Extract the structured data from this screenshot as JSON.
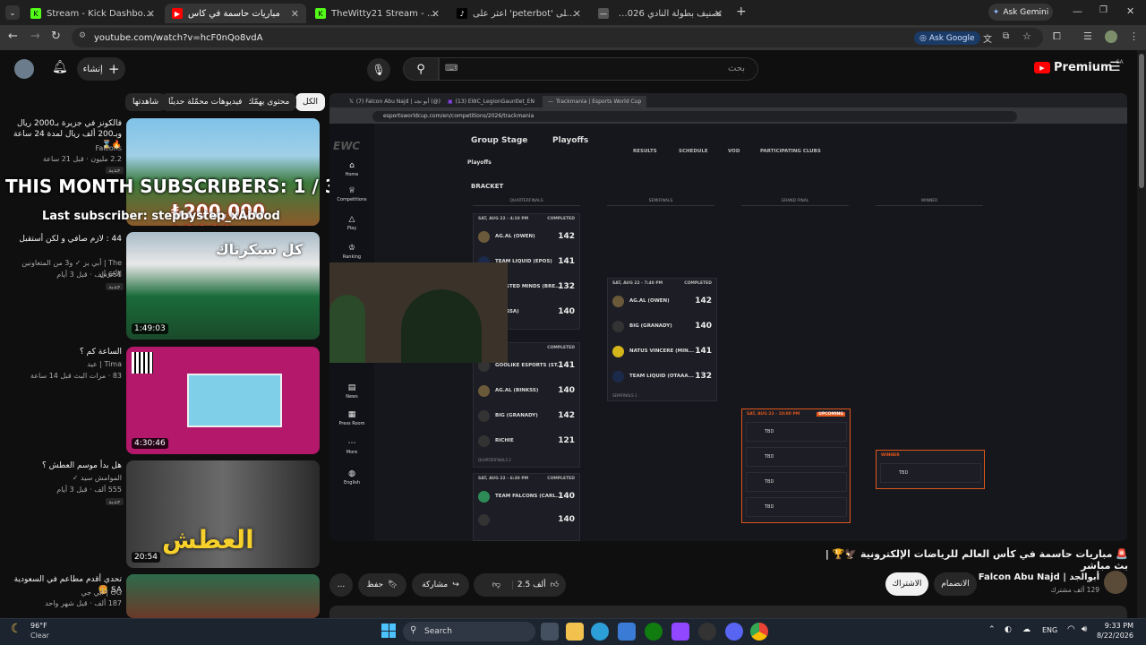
{
  "browser": {
    "tabs": [
      {
        "label": "Stream - Kick Dashboard",
        "icon": "kick-icon",
        "color": "#53fc18"
      },
      {
        "label": "مباريات حاسمة في كأس",
        "icon": "youtube-icon",
        "color": "#ff0000",
        "active": true
      },
      {
        "label": "TheWitty21 Stream - Watch Live",
        "icon": "kick-icon",
        "color": "#53fc18"
      },
      {
        "label": "اعثر على 'peterbot' على TikTok",
        "icon": "tiktok-icon",
        "color": "#000000"
      },
      {
        "label": "تصنيف بطولة النادي 2026 | كأس",
        "icon": "ewc-icon",
        "color": "#888888"
      }
    ],
    "ask_gemini": "Ask Gemini",
    "url": "youtube.com/watch?v=hcF0nQo8vdA",
    "ask_google": "Ask Google"
  },
  "youtube": {
    "create_label": "إنشاء",
    "search_placeholder": "بحث",
    "premium_label": "Premium",
    "premium_region": "SA",
    "chips": [
      "الكل",
      "محتوى يهمّك",
      "فيديوهات محمّلة حديثًا",
      "شاهدتها"
    ],
    "overlay_subs": "THIS MONTH SUBSCRIBERS: 1 / 30",
    "overlay_last": "Last subscriber: stepbystep_xAbood",
    "suggestions": [
      {
        "title": "فالكونز في جزيرة بـ2000 ريال وبـ200 ألف ريال لمدة 24 ساعة 🔥⌛",
        "channel": "Falcons",
        "meta": "2.2 مليون · قبل 21 ساعة",
        "badge": "جديد",
        "duration": ""
      },
      {
        "title": "44 : لازم صافي و لكن أستقبل",
        "channel": "The | أبي يز ✓ و3 من المتعاونين الآخرين",
        "meta": "651 ألف · قبل 3 أيام",
        "badge": "جديد",
        "duration": "1:49:03"
      },
      {
        "title": "الساعة كم ؟",
        "channel": "Tima | عيد",
        "meta": "83 · مرات البث قبل 14 ساعة",
        "badge": "جديد",
        "duration": "4:30:46"
      },
      {
        "title": "هل بدأ موسم العطش ؟",
        "channel": "الموامش سيد ✓",
        "meta": "555 ألف · قبل 3 أيام",
        "badge": "جديد",
        "duration": "20:54"
      },
      {
        "title": "تحدي أقدم مطاعم في السعودية SA 🍔",
        "channel": "OG | أبي جي",
        "meta": "187 ألف · قبل شهر واحد",
        "badge": "",
        "duration": ""
      }
    ],
    "video_title": "🚨 مباريات حاسمة في كأس العالم للرياضات الإلكترونية 🦅🏆 | بث مباشر",
    "channel_name": "أبوالجد | Falcon Abu Najd",
    "channel_subs": "129 ألف مشترك",
    "join_label": "الانضمام",
    "subscribe_label": "الاشتراك",
    "like_count": "2.5 ألف",
    "share_label": "مشاركة",
    "save_label": "حفظ",
    "more_label": "..."
  },
  "stream": {
    "inner_tabs": [
      "(7) Falcon Abu Najd | أبو نجد (@)",
      "(13) EWC_LegionGauntlet_EN",
      "Trackmania | Esports World Cup"
    ],
    "inner_url": "esportsworldcup.com/en/competitions/2026/trackmania",
    "ewc_logo": "EWC",
    "sidebar": [
      "Home",
      "Competitions",
      "Play",
      "Ranking",
      "Fan Fest",
      "News",
      "Press Room",
      "More",
      "English"
    ],
    "stages": [
      "Group Stage",
      "Playoffs"
    ],
    "subtabs": [
      "RESULTS",
      "SCHEDULE",
      "VOD",
      "PARTICIPATING CLUBS"
    ],
    "playoffs_label": "Playoffs",
    "bracket_label": "BRACKET",
    "columns": [
      "QUARTERFINALS",
      "SEMIFINALS",
      "GRAND FINAL",
      "WINNER"
    ],
    "quarterfinals": [
      {
        "date": "SAT, AUG 22 - 4:10 PM",
        "status": "COMPLETED",
        "teams": [
          [
            "AG.AL (OWEN)",
            "142"
          ],
          [
            "TEAM LIQUID (EPOS)",
            "141"
          ],
          [
            "TWISTED MINDS (BRE...",
            "132"
          ],
          [
            "(MASSA)",
            "140"
          ]
        ]
      },
      {
        "date": "5:30 PM",
        "status": "COMPLETED",
        "teams": [
          [
            "GOOLIKE ESPORTS (ST...",
            "141"
          ],
          [
            "AG.AL (BINKSS)",
            "140"
          ],
          [
            "BIG (GRANADY)",
            "142"
          ],
          [
            "RICHIE",
            "121"
          ]
        ]
      },
      {
        "date": "SAT, AUG 22 - 6:30 PM",
        "status": "COMPLETED",
        "teams": [
          [
            "TEAM FALCONS (CARL...",
            "140"
          ],
          [
            "",
            "140"
          ]
        ]
      }
    ],
    "semifinal": {
      "date": "SAT, AUG 22 - 7:40 PM",
      "status": "COMPLETED",
      "teams": [
        [
          "AG.AL (OWEN)",
          "142"
        ],
        [
          "BIG (GRANADY)",
          "140"
        ],
        [
          "NATUS VINCERE (MIN...",
          "141"
        ],
        [
          "TEAM LIQUID (OTAAA...",
          "132"
        ]
      ],
      "footer": "SEMIFINALS 1"
    },
    "qf_footer": "QUARTERFINALS 2",
    "grand_final": {
      "date": "SAT, AUG 22 - 10:00 PM",
      "status": "UPCOMING",
      "teams": [
        "TBD",
        "TBD",
        "TBD",
        "TBD"
      ]
    },
    "winner": {
      "label": "WINNER",
      "team": "TBD"
    }
  },
  "taskbar": {
    "weather_temp": "96°F",
    "weather_desc": "Clear",
    "search_label": "Search",
    "lang": "ENG",
    "time": "9:33 PM",
    "date": "8/22/2026"
  },
  "colors": {
    "accent": "#ff0000",
    "ewc_orange": "#e0561b",
    "bg": "#0f0f0f"
  }
}
